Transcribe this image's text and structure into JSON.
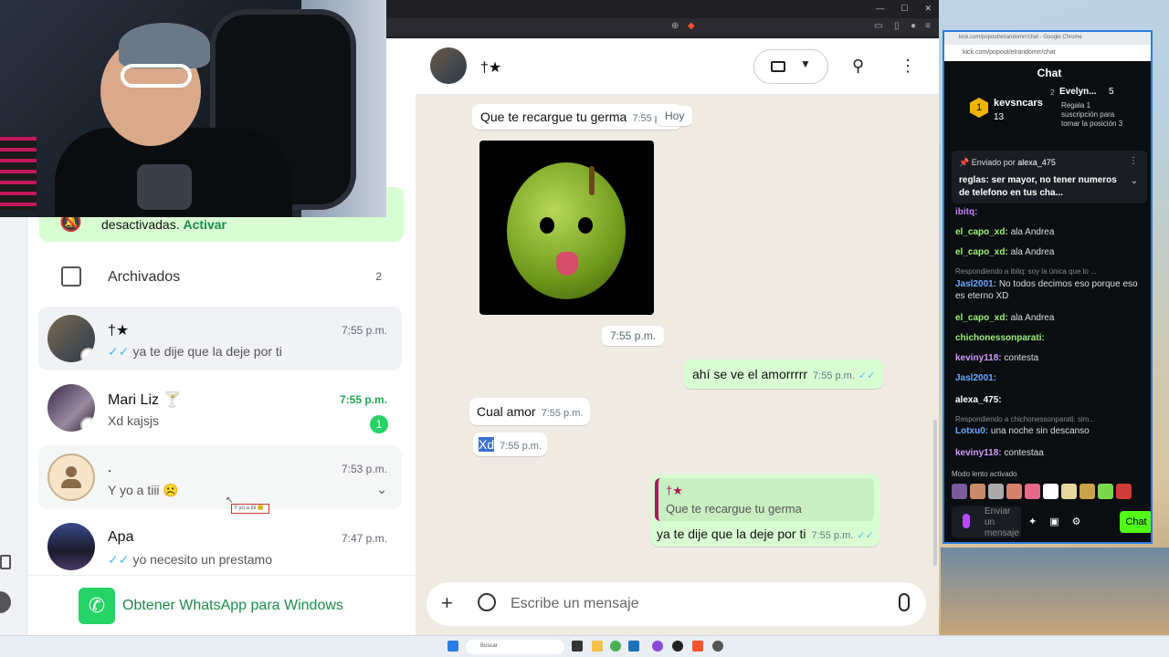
{
  "colors": {
    "accent": "#25d366",
    "out_bubble": "#d9fdd3",
    "read_tick": "#53bdeb",
    "kick_green": "#53fc18"
  },
  "sidebar": {
    "notification": {
      "text": "desactivadas.",
      "action": "Activar"
    },
    "archived": {
      "label": "Archivados",
      "count": "2"
    },
    "chats": [
      {
        "name": "†★",
        "time": "7:55 p.m.",
        "preview": "ya te dije que la deje por ti",
        "ticks": "✓✓"
      },
      {
        "name": "Mari Liz 🍸",
        "time": "7:55 p.m.",
        "preview": "Xd kajsjs",
        "unread": "1"
      },
      {
        "name": ".",
        "time": "7:53 p.m.",
        "preview": "Y yo a tiii ☹️"
      },
      {
        "name": "Apa",
        "time": "7:47 p.m.",
        "preview": "yo necesito un prestamo",
        "ticks": "✓✓"
      }
    ],
    "tooltip": "Y yo a tiii ☹️",
    "get_app": "Obtener WhatsApp para Windows"
  },
  "chat": {
    "contact_name": "†★",
    "day_chip": "Hoy",
    "messages": [
      {
        "dir": "in",
        "text": "Que te recargue tu germa",
        "time": "7:55 p.m."
      },
      {
        "dir": "in",
        "type": "image",
        "time": "7:55 p.m."
      },
      {
        "dir": "out",
        "text": "ahí se ve el amorrrrr",
        "time": "7:55 p.m.",
        "ticks": "✓✓"
      },
      {
        "dir": "in",
        "text": "Cual amor",
        "time": "7:55 p.m."
      },
      {
        "dir": "in",
        "text": "Xd",
        "time": "7:55 p.m."
      },
      {
        "dir": "out",
        "quote_name": "†★",
        "quote_text": "Que te recargue tu germa",
        "text": "ya te dije que la deje por ti",
        "time": "7:55 p.m.",
        "ticks": "✓✓"
      }
    ],
    "composer_placeholder": "Escribe un mensaje"
  },
  "kick": {
    "window_title": "kick.com/popout/elrandomrr/chat - Google Chrome",
    "url": "kick.com/popout/elrandomrr/chat",
    "header": "Chat",
    "top_gifters": [
      {
        "rank": "1",
        "name": "kevsncars",
        "count": "13"
      },
      {
        "rank": "2",
        "name": "Evelyn...",
        "count": "5",
        "note": "Regala 1 suscripción para tomar la posición 3"
      }
    ],
    "pinned": {
      "by_label": "Enviado por",
      "by_user": "alexa_475",
      "text": "reglas: ser mayor, no tener numeros de telefono en tus cha..."
    },
    "lines": [
      {
        "user": "ibitq:",
        "msg": "",
        "color": "#c77dff"
      },
      {
        "user": "el_capo_xd:",
        "msg": "ala Andrea",
        "color": "#9ef07a"
      },
      {
        "user": "el_capo_xd:",
        "msg": "ala Andrea",
        "color": "#9ef07a"
      },
      {
        "reply": "Respondiendo a ibitq: soy la única que lo ..."
      },
      {
        "user": "Jasl2001:",
        "msg": "No todos decimos eso porque eso es eterno XD",
        "color": "#6aa8ff"
      },
      {
        "user": "el_capo_xd:",
        "msg": "ala Andrea",
        "color": "#9ef07a"
      },
      {
        "user": "chichonessonparati:",
        "msg": "",
        "color": "#9ef07a"
      },
      {
        "user": "keviny118:",
        "msg": "contesta",
        "color": "#d29bff"
      },
      {
        "user": "Jasl2001:",
        "msg": "",
        "color": "#6aa8ff"
      },
      {
        "user": "alexa_475:",
        "msg": "",
        "color": "#ffffff"
      },
      {
        "reply": "Respondiendo a chichonessonparati: sim..."
      },
      {
        "user": "Lotxu0:",
        "msg": "una noche sin descanso",
        "color": "#6aa8ff"
      },
      {
        "user": "keviny118:",
        "msg": "contestaa",
        "color": "#d29bff"
      }
    ],
    "slow_mode": "Modo lento activado",
    "input_placeholder": "Enviar un mensaje",
    "chat_button": "Chat"
  },
  "taskbar": {
    "search": "Buscar"
  }
}
